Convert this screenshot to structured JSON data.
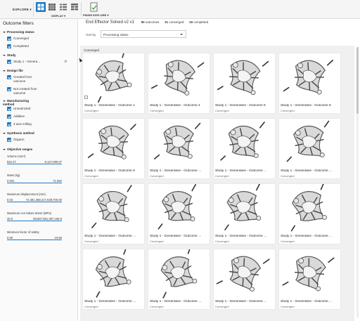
{
  "toolbar": {
    "explore_label": "EXPLORE ▾",
    "display_label": "DISPLAY ▾",
    "finish_label": "FINISH EXPLORE ▾",
    "icons": [
      "large-thumbnail-grid-icon",
      "small-thumbnail-grid-icon",
      "list-view-icon",
      "table-view-icon",
      "finish-explore-icon"
    ]
  },
  "sidebar": {
    "title": "Outcome filters",
    "groups": {
      "processing": "Processing status",
      "study": "Study",
      "design": "Design file",
      "mfg": "Manufacturing method",
      "synth": "Synthesis method",
      "objective": "Objective ranges"
    },
    "checks": {
      "converged": "Converged",
      "completed": "Completed",
      "study1": "Study 1 - Genera...",
      "created": "Created from outcome",
      "not_created": "Not created from outcome",
      "unrestricted": "Unrestricted",
      "additive": "Additive",
      "milling": "3 axis milling",
      "organic": "Organic"
    },
    "ranges": [
      {
        "label": "Volume (mm³)",
        "min": "922.37",
        "max": "9,127,090.07"
      },
      {
        "label": "Mass (kg)",
        "min": "0.001",
        "max": "71.652"
      },
      {
        "label": "Maximum displacement (mm)",
        "min": "0.03",
        "max": "72,481,358,217,539,700.00"
      },
      {
        "label": "Maximum von Mises stress (MPa)",
        "min": "30.0",
        "max": "86,987,691,397,169.8"
      },
      {
        "label": "Minimum factor of safety",
        "min": "0.00",
        "max": "10.66"
      }
    ],
    "accent": "#1f78c1"
  },
  "main": {
    "title": "End Effector Solved v2 v1",
    "counts": {
      "outcomes_n": "50",
      "outcomes_t": "outcomes",
      "converged_n": "31",
      "converged_t": "converged",
      "completed_n": "19",
      "completed_t": "completed"
    },
    "sort_label": "Sort by",
    "sort_value": "Processing status",
    "section_label": "Converged",
    "cards": [
      {
        "name": "Study 1 - Generative - Outcome 1",
        "status": "Converged"
      },
      {
        "name": "Study 1 - Generative - Outcome 4",
        "status": "Converged"
      },
      {
        "name": "Study 1 - Generative - Outcome 6",
        "status": "Converged"
      },
      {
        "name": "Study 1 - Generative - Outcome 8",
        "status": "Converged"
      },
      {
        "name": "Study 1 - Generative - Outcome 9",
        "status": "Converged"
      },
      {
        "name": "Study 1 - Generative - Outcome ...",
        "status": "Converged"
      },
      {
        "name": "Study 1 - Generative - Outcome ...",
        "status": "Converged"
      },
      {
        "name": "Study 1 - Generative - Outcome ...",
        "status": "Converged"
      },
      {
        "name": "Study 1 - Generative - Outcome ...",
        "status": "Converged"
      },
      {
        "name": "Study 1 - Generative - Outcome ...",
        "status": "Converged"
      },
      {
        "name": "Study 1 - Generative - Outcome ...",
        "status": "Converged"
      },
      {
        "name": "Study 1 - Generative - Outcome ...",
        "status": "Converged"
      },
      {
        "name": "Study 1 - Generative - Outcome ...",
        "status": "Converged"
      },
      {
        "name": "Study 1 - Generative - Outcome ...",
        "status": "Converged"
      },
      {
        "name": "Study 1 - Generative - Outcome ...",
        "status": "Converged"
      },
      {
        "name": "Study 1 - Generative - Outcome ...",
        "status": "Converged"
      }
    ]
  }
}
